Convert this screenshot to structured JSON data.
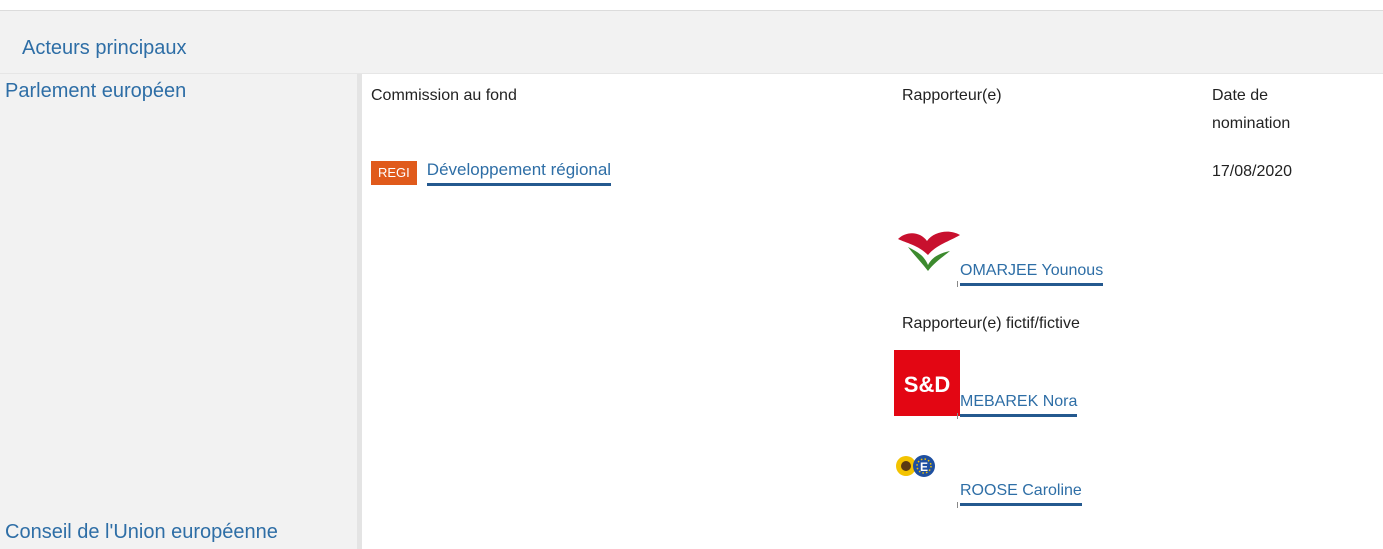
{
  "section": {
    "title": "Acteurs principaux"
  },
  "bodies": {
    "parliament": "Parlement européen",
    "council": "Conseil de l'Union européenne"
  },
  "columns": {
    "committee": "Commission au fond",
    "rapporteur": "Rapporteur(e)",
    "date_line1": "Date de",
    "date_line2": "nomination"
  },
  "committee": {
    "code": "REGI",
    "name": "Développement régional",
    "date": "17/08/2020"
  },
  "rapporteur": {
    "name": "OMARJEE Younous",
    "group_icon": "gue-ngl-logo-icon"
  },
  "shadow_label": "Rapporteur(e) fictif/fictive",
  "shadows": [
    {
      "name": "MEBAREK Nora",
      "group_icon": "sd-logo-icon",
      "logo_text": "S&D"
    },
    {
      "name": "ROOSE Caroline",
      "group_icon": "greens-efa-logo-icon"
    }
  ],
  "colors": {
    "link": "#2e6ea6",
    "badge": "#e05a1b",
    "sd_red": "#e30613"
  }
}
